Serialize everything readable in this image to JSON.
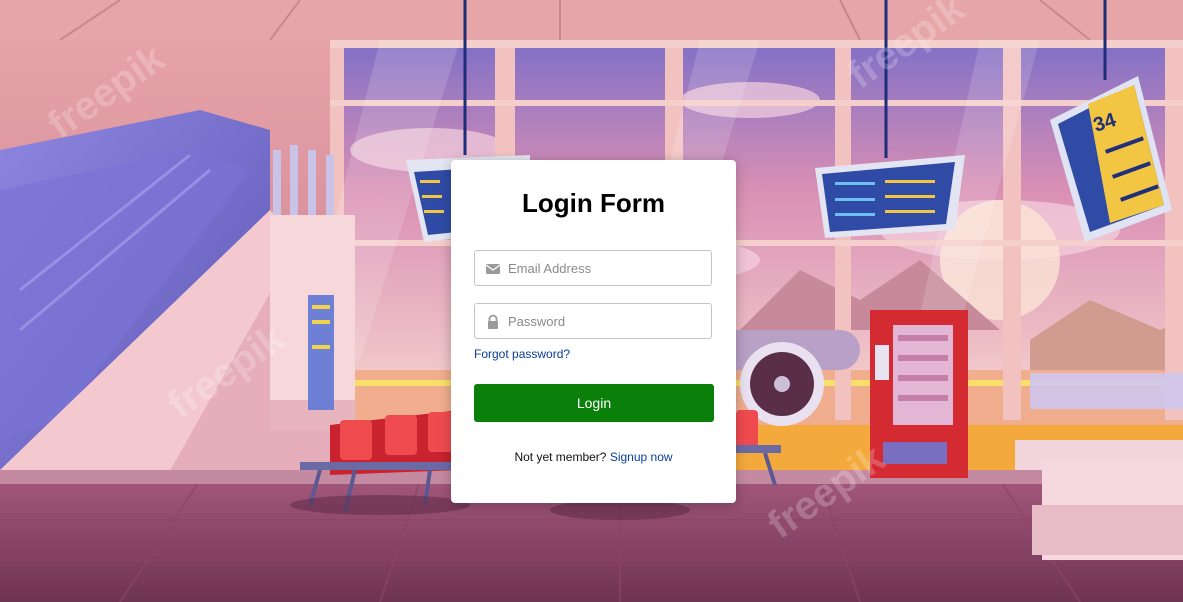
{
  "form": {
    "title": "Login Form",
    "email_placeholder": "Email Address",
    "password_placeholder": "Password",
    "forgot_label": "Forgot password?",
    "login_label": "Login",
    "signup_prompt": "Not yet member?",
    "signup_link": "Signup now"
  },
  "background": {
    "board_number": "34",
    "watermark": "freepik"
  },
  "colors": {
    "login_button": "#0a7f0a",
    "link": "#0a3d9c",
    "card": "#ffffff"
  },
  "icons": {
    "email": "envelope-icon",
    "password": "lock-icon"
  }
}
